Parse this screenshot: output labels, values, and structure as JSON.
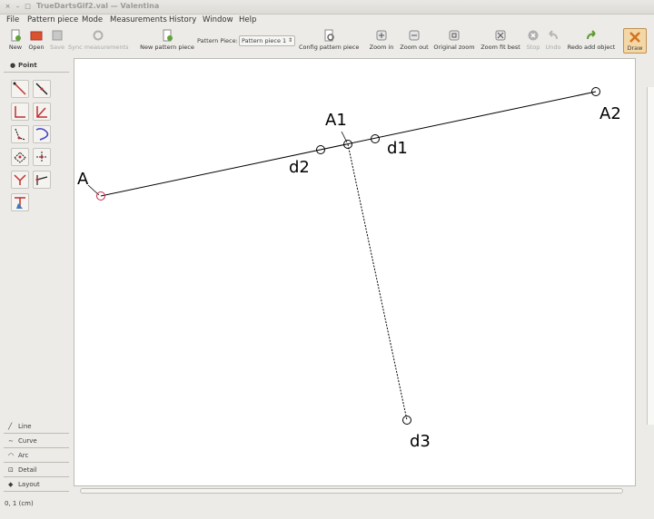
{
  "window": {
    "title": "TrueDartsGif2.val — Valentina"
  },
  "menu": [
    "File",
    "Pattern piece",
    "Mode",
    "Measurements",
    "History",
    "Window",
    "Help"
  ],
  "toolbar": {
    "new": "New",
    "open": "Open",
    "save": "Save",
    "sync": "Sync measurements",
    "new_pattern_piece": "New pattern piece",
    "pattern_piece_label": "Pattern Piece:",
    "pattern_piece_value": "Pattern piece 1",
    "config": "Config pattern piece",
    "zoom_in": "Zoom in",
    "zoom_out": "Zoom out",
    "zoom_original": "Original zoom",
    "zoom_fit": "Zoom fit best",
    "stop": "Stop",
    "undo": "Undo",
    "redo": "Redo add object",
    "draw": "Draw"
  },
  "sidebar": {
    "active_tab": "Point",
    "tabs": [
      "Line",
      "Curve",
      "Arc",
      "Detail",
      "Layout"
    ]
  },
  "canvas": {
    "points": [
      "A",
      "A1",
      "A2",
      "d1",
      "d2",
      "d3"
    ]
  },
  "status": {
    "text": "0, 1 (cm)"
  }
}
